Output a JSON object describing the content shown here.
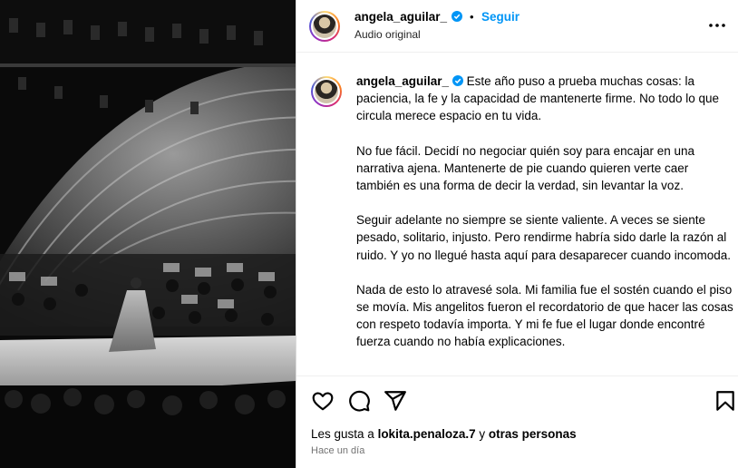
{
  "post": {
    "username": "angela_aguilar_",
    "dot": "•",
    "follow_label": "Seguir",
    "audio": "Audio original",
    "more_icon": "more-horizontal-icon"
  },
  "caption": {
    "first_line": "Este año puso a prueba muchas cosas: la paciencia, la fe y la capacidad de mantenerte firme. No todo lo que circula merece espacio en tu vida.",
    "paragraphs": [
      "No fue fácil. Decidí no negociar quién soy para encajar en una narrativa ajena. Mantenerte de pie cuando quieren verte caer también es una forma de decir la verdad, sin levantar la voz.",
      "Seguir adelante no siempre se siente valiente. A veces se siente pesado, solitario, injusto. Pero rendirme habría sido darle la razón al ruido. Y yo no llegué hasta aquí para desaparecer cuando incomoda.",
      "Nada de esto lo atravesé sola. Mi familia fue el sostén cuando el piso se movía. Mis angelitos fueron el recordatorio de que hacer las cosas con respeto todavía importa. Y mi fe fue el lugar donde encontré fuerza cuando no había explicaciones."
    ]
  },
  "actions": {
    "icons": [
      "heart-icon",
      "comment-icon",
      "share-icon",
      "save-icon"
    ],
    "likes_prefix": "Les gusta a ",
    "likes_user": "lokita.penaloza.7",
    "likes_suffix": " y ",
    "likes_others": "otras personas",
    "timestamp": "Hace un día"
  },
  "colors": {
    "accent": "#0095f6",
    "verified": "#0095f6",
    "muted": "#737373"
  }
}
